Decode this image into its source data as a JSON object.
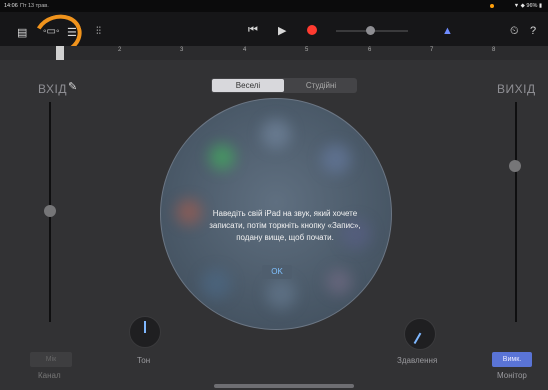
{
  "status": {
    "time": "14:06",
    "date": "Пт 13 трав.",
    "battery": "96%"
  },
  "toolbar": {
    "icons": [
      "document-icon",
      "track-view-icon",
      "mixer-icon",
      "settings-sliders-icon"
    ],
    "transport": [
      "rewind-icon",
      "play-icon",
      "record-icon"
    ],
    "metronome": "metronome-icon",
    "right_icons": [
      "clock-icon",
      "help-icon"
    ]
  },
  "ruler": {
    "marks": [
      "1",
      "2",
      "3",
      "4",
      "5",
      "6",
      "7",
      "8"
    ]
  },
  "input": {
    "label": "ВХІД"
  },
  "output": {
    "label": "ВИХІД"
  },
  "mode": {
    "fun": "Веселі",
    "studio": "Студійні"
  },
  "dialog": {
    "message": "Наведіть свій iPad на звук, який хочете записати, потім торкніть кнопку «Запис», подану вище, щоб почати.",
    "ok": "OK"
  },
  "knobs": {
    "tone": "Тон",
    "compression": "Здавлення"
  },
  "buttons": {
    "mic": "Мік",
    "channel": "Канал",
    "monitor_btn": "Вимк.",
    "monitor": "Монітор"
  },
  "levels": {
    "input_slider": 0.55,
    "output_slider": 0.75
  }
}
